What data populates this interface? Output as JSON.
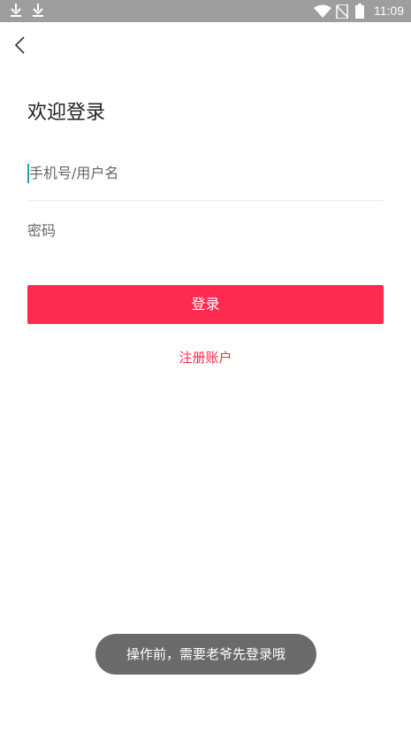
{
  "status_bar": {
    "time": "11:09",
    "left_icons": [
      "download-icon",
      "download-icon"
    ],
    "right_icons": [
      "wifi-icon",
      "no-sim-icon",
      "battery-icon"
    ]
  },
  "nav": {
    "back_icon": "chevron-left-icon"
  },
  "login": {
    "title": "欢迎登录",
    "username_placeholder": "手机号/用户名",
    "password_placeholder": "密码",
    "login_label": "登录",
    "register_label": "注册账户"
  },
  "toast": {
    "message": "操作前，需要老爷先登录哦"
  },
  "colors": {
    "status_bar": "#9e9e9e",
    "accent": "#ff2a50",
    "caret": "#1aa7a7",
    "toast_bg": "#6a6a6a"
  }
}
